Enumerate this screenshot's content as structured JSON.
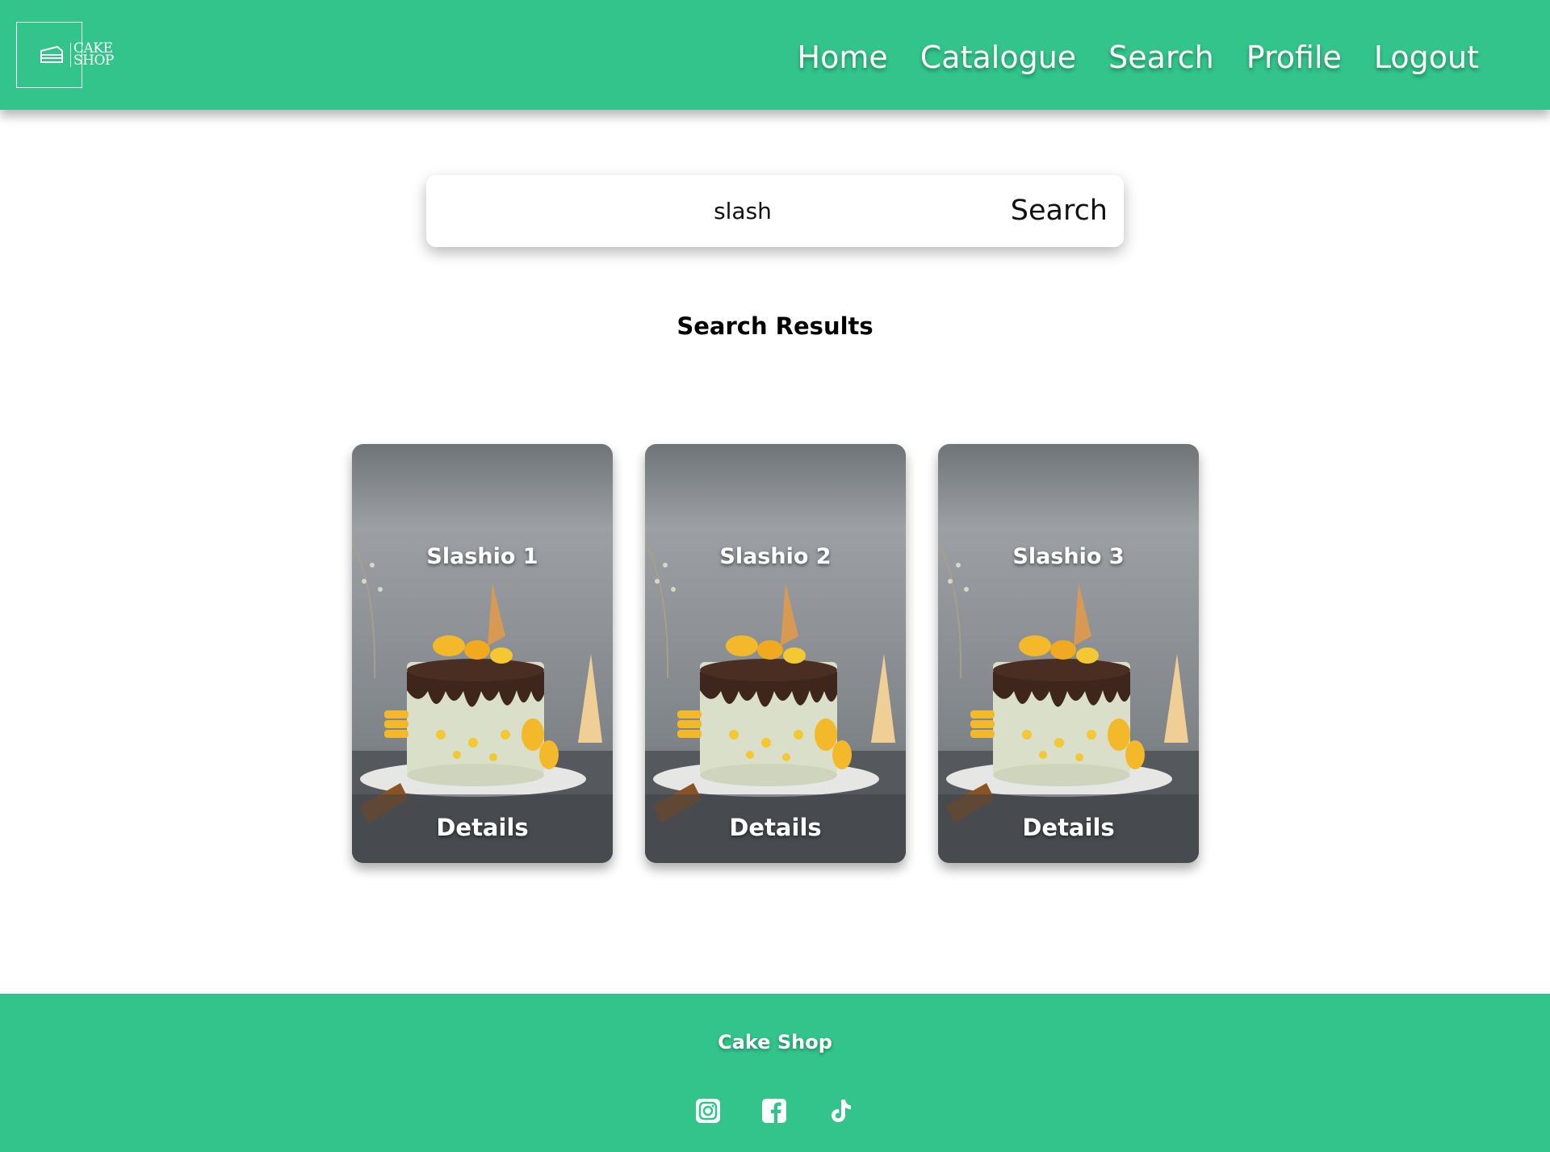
{
  "header": {
    "logo_text": "CAKE\nSHOP",
    "nav": [
      "Home",
      "Catalogue",
      "Search",
      "Profile",
      "Logout"
    ]
  },
  "search": {
    "value": "slash",
    "button_label": "Search"
  },
  "results": {
    "title": "Search Results",
    "cards": [
      {
        "name": "Slashio 1",
        "action": "Details"
      },
      {
        "name": "Slashio 2",
        "action": "Details"
      },
      {
        "name": "Slashio 3",
        "action": "Details"
      }
    ]
  },
  "footer": {
    "title": "Cake Shop",
    "icons": [
      "instagram-icon",
      "facebook-icon",
      "tiktok-icon"
    ]
  },
  "colors": {
    "brand_green": "#32c48a",
    "text_white": "#ffffff"
  }
}
